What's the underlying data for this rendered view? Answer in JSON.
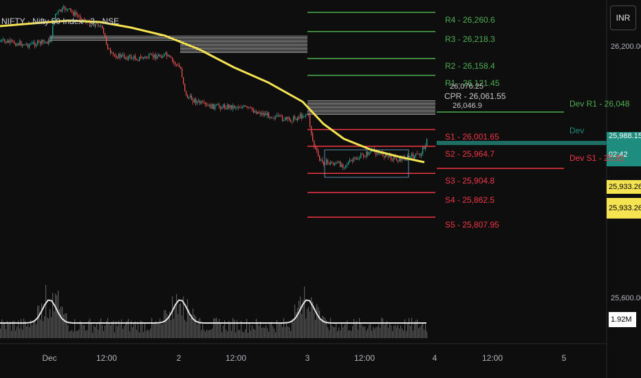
{
  "symbol": "NIFTY · Nifty 50 Index · 3 · NSE",
  "currency_button": "INR",
  "price_axis": {
    "top_label": "26,200.00",
    "bottom_label": "25,600.00",
    "last_price": "25,988.15",
    "countdown": "02:42",
    "ma_label_1": "25,933.26",
    "ma_label_2": "25,933.26",
    "volume_label": "1.92M"
  },
  "time_axis": [
    "Dec",
    "12:00",
    "2",
    "12:00",
    "3",
    "12:00",
    "4",
    "12:00",
    "5"
  ],
  "pivot_levels": [
    {
      "name": "R4",
      "text": "R4 - 26,260.6",
      "value": 26260.6,
      "color": "#4caf50"
    },
    {
      "name": "R3",
      "text": "R3 - 26,218.3",
      "value": 26218.3,
      "color": "#4caf50"
    },
    {
      "name": "R2",
      "text": "R2 - 26,158.4",
      "value": 26158.4,
      "color": "#4caf50"
    },
    {
      "name": "R1",
      "text": "R1 - 26,121.45",
      "value": 26121.45,
      "color": "#4caf50"
    },
    {
      "name": "S1",
      "text": "S1 - 26,001.65",
      "value": 26001.65,
      "color": "#f23645"
    },
    {
      "name": "S2",
      "text": "S2 - 25,964.7",
      "value": 25964.7,
      "color": "#f23645"
    },
    {
      "name": "S3",
      "text": "S3 - 25,904.8",
      "value": 25904.8,
      "color": "#f23645"
    },
    {
      "name": "S4",
      "text": "S4 - 25,862.5",
      "value": 25862.5,
      "color": "#f23645"
    },
    {
      "name": "S5",
      "text": "S5 - 25,807.95",
      "value": 25807.95,
      "color": "#f23645"
    }
  ],
  "cpr_labels": {
    "cpr": "CPR - 26,061.55",
    "tc": "26,076.25",
    "bc": "26,046.9"
  },
  "developing_levels": {
    "dev_r1": "Dev R1 - 26,048",
    "dev_s1": "Dev S1 - 25,91",
    "dev_mid": "Dev"
  },
  "colors": {
    "up": "#26a69a",
    "down": "#ef5350",
    "ma": "#f5e351",
    "support": "#f23645",
    "resistance": "#4caf50",
    "last_price_bg": "#1e8c7e",
    "ma_tag_bg": "#f5e351"
  },
  "chart_data": {
    "type": "line",
    "ylim": [
      25807.95,
      26260.6
    ],
    "series": [
      {
        "values": [
          26210,
          26225,
          26215,
          26200,
          26185,
          26160,
          26145,
          26130,
          26110,
          26090,
          26080,
          26070,
          26060,
          26050,
          26040,
          26030,
          26000,
          25990,
          25975,
          25965,
          25960,
          25950,
          25945
        ]
      },
      {
        "values": [
          26240,
          26235,
          26230,
          26222,
          26210,
          26195,
          26175,
          26150,
          26125,
          26100,
          26080,
          26065,
          26050,
          26030,
          26010,
          25990,
          25970,
          25955,
          25945,
          25938,
          25933
        ]
      }
    ]
  }
}
